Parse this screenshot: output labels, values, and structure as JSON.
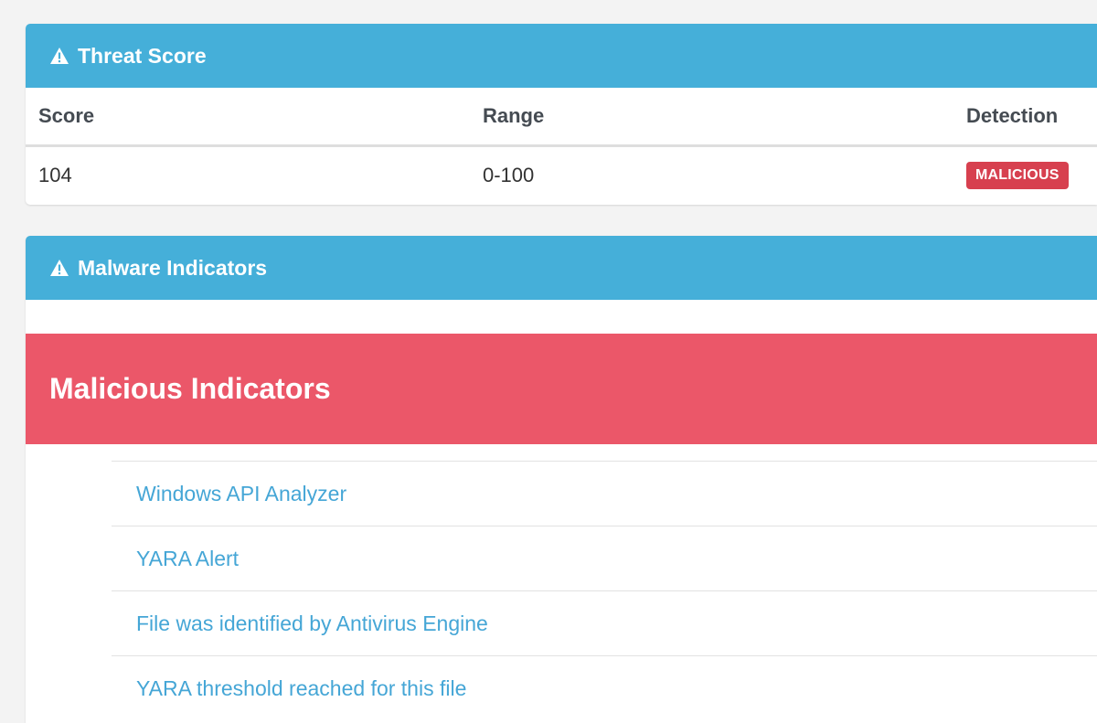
{
  "colors": {
    "heading_bg": "#45afd9",
    "malicious_header_bg": "#eb5769",
    "badge_bg": "#d7404f",
    "link": "#45a6d6"
  },
  "threat_score": {
    "title": "Threat Score",
    "icon": "warning-icon",
    "columns": {
      "score": "Score",
      "range": "Range",
      "detection": "Detection"
    },
    "row": {
      "score": "104",
      "range": "0-100",
      "detection": "MALICIOUS"
    }
  },
  "malware_indicators": {
    "title": "Malware Indicators",
    "icon": "warning-icon",
    "malicious_title": "Malicious Indicators",
    "items": [
      {
        "label": "Windows API Analyzer"
      },
      {
        "label": "YARA Alert"
      },
      {
        "label": "File was identified by Antivirus Engine"
      },
      {
        "label": "YARA threshold reached for this file"
      }
    ]
  }
}
